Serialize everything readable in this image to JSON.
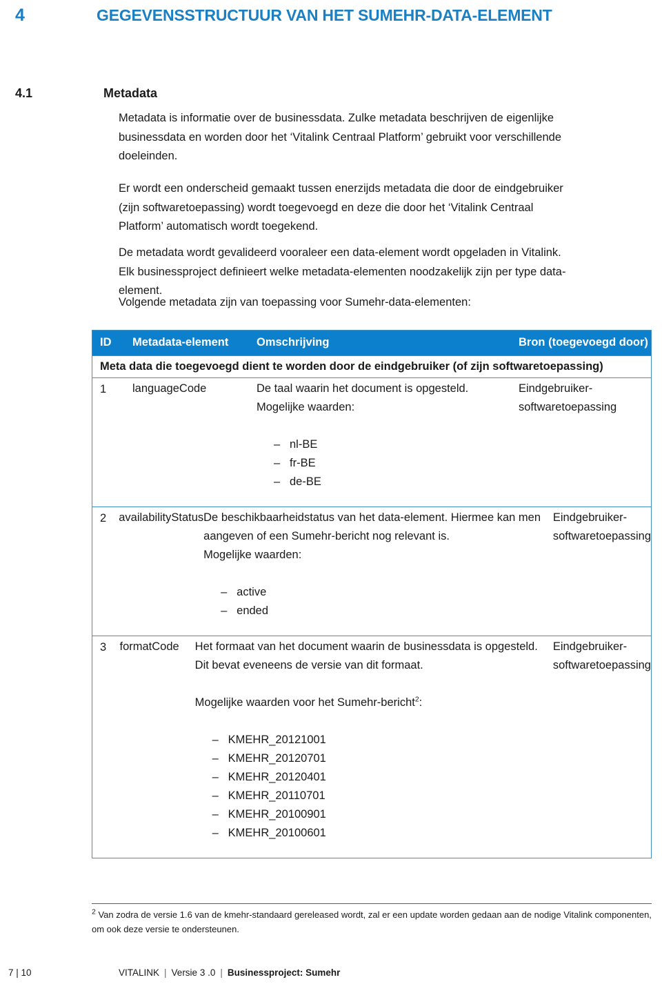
{
  "chapter": {
    "number": "4",
    "title": "GEGEVENSSTRUCTUUR VAN HET SUMEHR-DATA-ELEMENT",
    "color": "#1b7fc3"
  },
  "section": {
    "number": "4.1",
    "title": "Metadata"
  },
  "paragraphs": {
    "p1": "Metadata is informatie over de businessdata. Zulke metadata beschrijven de eigenlijke businessdata en worden door het ‘Vitalink Centraal Platform’ gebruikt voor verschillende doeleinden.",
    "p2": "Er wordt een onderscheid gemaakt tussen enerzijds metadata die door de eindgebruiker (zijn softwaretoepassing) wordt toegevoegd en deze die door het ‘Vitalink Centraal Platform’ automatisch wordt toegekend.",
    "p3": "De metadata wordt gevalideerd vooraleer een data-element wordt opgeladen in Vitalink. Elk businessproject definieert welke metadata-elementen noodzakelijk zijn per type data-element.",
    "p4": "Volgende metadata zijn van toepassing voor Sumehr-data-elementen:"
  },
  "table": {
    "header_bg": "#0c80cc",
    "border_color": "#3f8fc0",
    "columns": [
      "ID",
      "Metadata-element",
      "Omschrijving",
      "Bron (toegevoegd door)"
    ],
    "group_header": "Meta data die toegevoegd dient te worden door de eindgebruiker (of zijn softwaretoepassing)",
    "rows": [
      {
        "id": "1",
        "element": "languageCode",
        "description_lines": [
          "De taal waarin het document is opgesteld.",
          "Mogelijke waarden:"
        ],
        "values": [
          "nl-BE",
          "fr-BE",
          "de-BE"
        ],
        "source": "Eindgebruiker-softwaretoepassing"
      },
      {
        "id": "2",
        "element": "availabilityStatus",
        "description_lines": [
          "De beschikbaarheidstatus van het data-element. Hiermee kan men aangeven of een Sumehr-bericht nog relevant is.",
          "Mogelijke waarden:"
        ],
        "values": [
          "active",
          "ended"
        ],
        "source": "Eindgebruiker-softwaretoepassing"
      },
      {
        "id": "3",
        "element": "formatCode",
        "description_lines": [
          "Het formaat van het document waarin de businessdata is opgesteld. Dit bevat eveneens de versie van dit formaat.",
          "Mogelijke waarden voor het Sumehr-bericht"
        ],
        "description_suffix": ":",
        "footnote_marker": "2",
        "values": [
          "KMEHR_20121001",
          "KMEHR_20120701",
          "KMEHR_20120401",
          "KMEHR_20110701",
          "KMEHR_20100901",
          "KMEHR_20100601"
        ],
        "source": "Eindgebruiker-softwaretoepassing"
      }
    ],
    "bullet_dash": "–"
  },
  "footnote": {
    "marker": "2",
    "text": "Van zodra de versie 1.6 van de kmehr-standaard gereleased wordt, zal er een update worden gedaan aan de nodige Vitalink componenten, om ook deze versie te ondersteunen."
  },
  "footer": {
    "pages": "7 | 10",
    "brand": "VITALINK",
    "version": "Versie 3 .0",
    "project": "Businessproject: Sumehr",
    "separator": "|"
  }
}
